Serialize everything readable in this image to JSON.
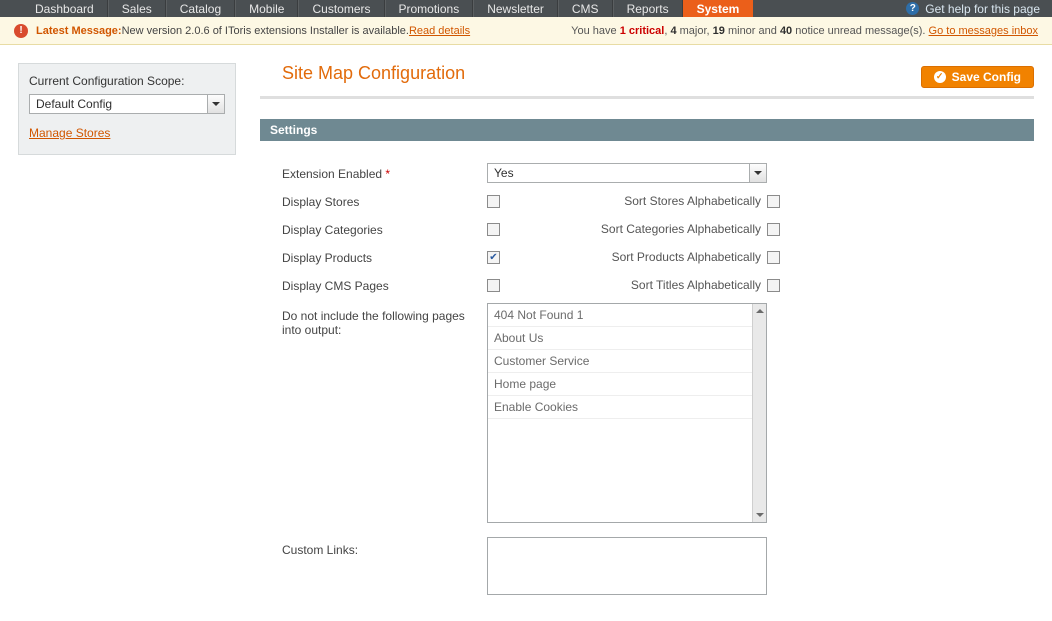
{
  "nav": {
    "tabs": [
      {
        "label": "Dashboard"
      },
      {
        "label": "Sales"
      },
      {
        "label": "Catalog"
      },
      {
        "label": "Mobile"
      },
      {
        "label": "Customers"
      },
      {
        "label": "Promotions"
      },
      {
        "label": "Newsletter"
      },
      {
        "label": "CMS"
      },
      {
        "label": "Reports"
      },
      {
        "label": "System",
        "active": true
      }
    ],
    "help": "Get help for this page"
  },
  "msgbar": {
    "latest_label": "Latest Message:",
    "latest_text": " New version 2.0.6 of IToris extensions Installer is available. ",
    "read_details": "Read details",
    "right_pre": "You have ",
    "crit": "1 critical",
    "mid1": ", ",
    "major": "4",
    "mid2": " major, ",
    "minor": "19",
    "mid3": " minor and ",
    "notice": "40",
    "mid4": " notice unread message(s). ",
    "inbox": "Go to messages inbox"
  },
  "scope": {
    "title": "Current Configuration Scope:",
    "value": "Default Config",
    "manage": "Manage Stores"
  },
  "page": {
    "title": "Site Map Configuration",
    "save": "Save Config",
    "panel": "Settings"
  },
  "form": {
    "ext_enabled": {
      "label": "Extension Enabled",
      "value": "Yes"
    },
    "display_stores": {
      "label": "Display Stores",
      "sort": "Sort Stores Alphabetically"
    },
    "display_categories": {
      "label": "Display Categories",
      "sort": "Sort Categories Alphabetically"
    },
    "display_products": {
      "label": "Display Products",
      "sort": "Sort Products Alphabetically"
    },
    "display_cms": {
      "label": "Display CMS Pages",
      "sort": "Sort Titles Alphabetically"
    },
    "exclude": {
      "label": "Do not include the following pages into output:",
      "options": [
        "404 Not Found 1",
        "About Us",
        "Customer Service",
        "Home page",
        "Enable Cookies"
      ]
    },
    "custom_links": {
      "label": "Custom Links:"
    }
  }
}
